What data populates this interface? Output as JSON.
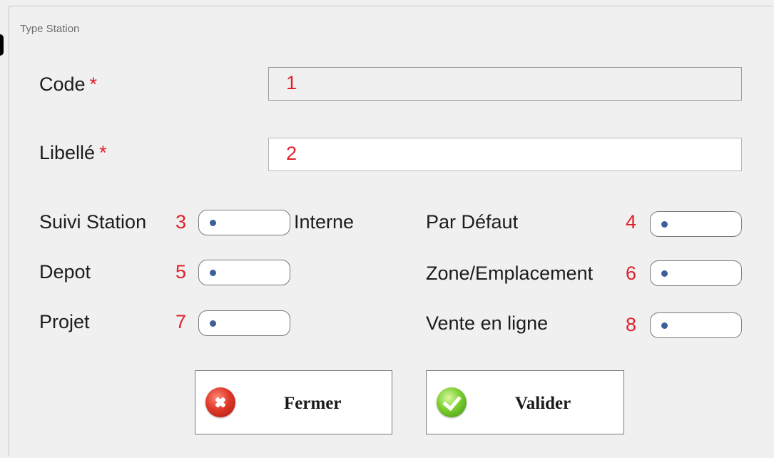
{
  "group": {
    "title": "Type Station"
  },
  "fields": {
    "code": {
      "label": "Code",
      "required_mark": "*",
      "number": "1"
    },
    "libelle": {
      "label": "Libellé",
      "required_mark": "*",
      "number": "2"
    }
  },
  "toggles": {
    "suivi_station": {
      "label": "Suivi Station",
      "number": "3",
      "suffix": "Interne"
    },
    "par_defaut": {
      "label": "Par Défaut",
      "number": "4"
    },
    "depot": {
      "label": "Depot",
      "number": "5"
    },
    "zone_emplacement": {
      "label": "Zone/Emplacement",
      "number": "6"
    },
    "projet": {
      "label": "Projet",
      "number": "7"
    },
    "vente_en_ligne": {
      "label": "Vente en ligne",
      "number": "8"
    }
  },
  "buttons": {
    "fermer": {
      "label": "Fermer",
      "icon": "close-icon"
    },
    "valider": {
      "label": "Valider",
      "icon": "check-icon"
    }
  },
  "colors": {
    "required": "#e0202a",
    "knob": "#3d5f9c"
  }
}
